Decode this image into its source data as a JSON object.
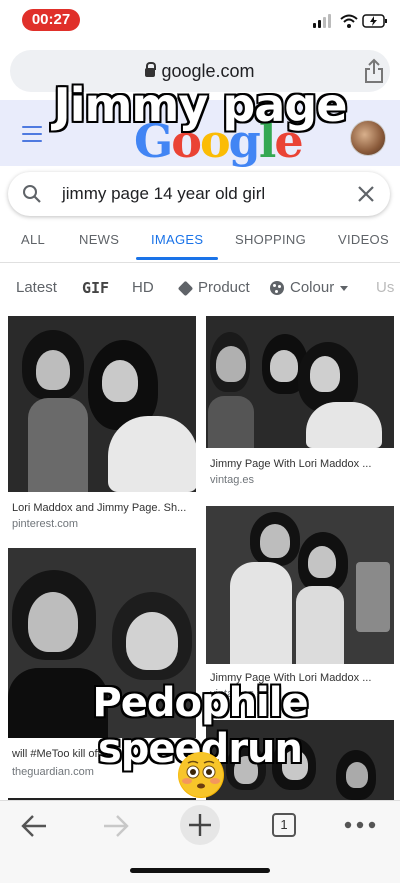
{
  "status_bar": {
    "time": "00:27"
  },
  "browser": {
    "url": "google.com"
  },
  "google": {
    "doodle": "Google"
  },
  "search": {
    "query": "jimmy page 14 year old girl"
  },
  "tabs": [
    {
      "label": "ALL"
    },
    {
      "label": "NEWS"
    },
    {
      "label": "IMAGES"
    },
    {
      "label": "SHOPPING"
    },
    {
      "label": "VIDEOS"
    }
  ],
  "filters": [
    {
      "label": "Latest"
    },
    {
      "label": "GIF"
    },
    {
      "label": "HD"
    },
    {
      "label": "Product"
    },
    {
      "label": "Colour"
    },
    {
      "label": "Us"
    }
  ],
  "results": [
    {
      "title": "Lori Maddox and Jimmy Page. Sh...",
      "source": "pinterest.com"
    },
    {
      "title": "Jimmy Page With Lori Maddox ...",
      "source": "vintag.es"
    },
    {
      "title": "will #MeToo kill off ...",
      "source": "theguardian.com"
    },
    {
      "title": "Jimmy Page With Lori Maddox ...",
      "source": "vintag.es"
    }
  ],
  "captions": {
    "top": "Jimmy page",
    "bottom": "Pedophile speedrun"
  },
  "toolbar": {
    "tab_count": "1"
  },
  "colors": {
    "accent": "#1a73e8",
    "time_pill": "#e0302a"
  }
}
